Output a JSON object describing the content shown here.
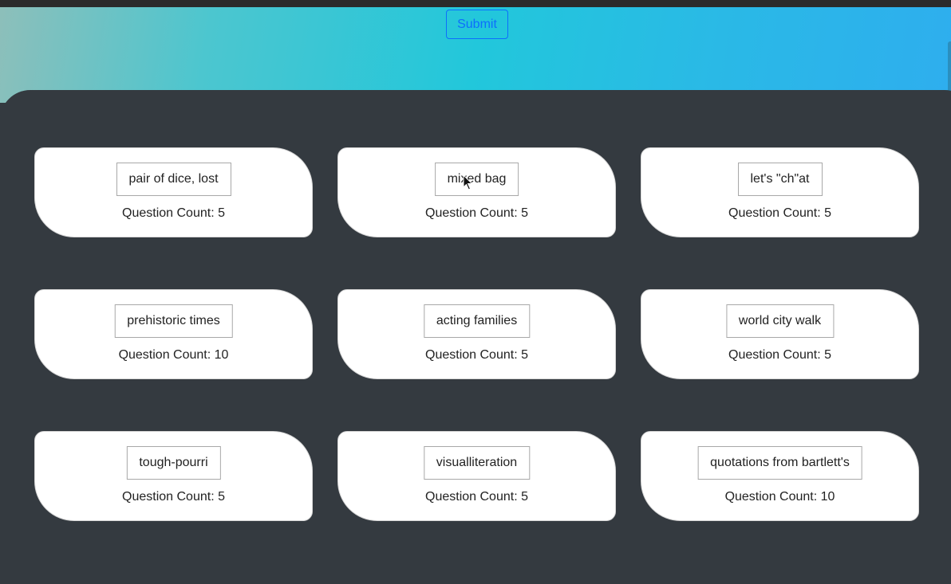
{
  "header": {
    "submit_label": "Submit",
    "colors": {
      "banner_gradient": [
        "#8dbfba",
        "#22c7db",
        "#2eaeee"
      ],
      "submit_accent": "#0d6efd",
      "panel_background": "#343a40"
    }
  },
  "categories": [
    {
      "title": "pair of dice, lost",
      "count_text": "Question Count: 5"
    },
    {
      "title": "mixed bag",
      "count_text": "Question Count: 5"
    },
    {
      "title": "let's \"ch\"at",
      "count_text": "Question Count: 5"
    },
    {
      "title": "prehistoric times",
      "count_text": "Question Count: 10"
    },
    {
      "title": "acting families",
      "count_text": "Question Count: 5"
    },
    {
      "title": "world city walk",
      "count_text": "Question Count: 5"
    },
    {
      "title": "tough-pourri",
      "count_text": "Question Count: 5"
    },
    {
      "title": "visualliteration",
      "count_text": "Question Count: 5"
    },
    {
      "title": "quotations from bartlett's",
      "count_text": "Question Count: 10"
    }
  ]
}
